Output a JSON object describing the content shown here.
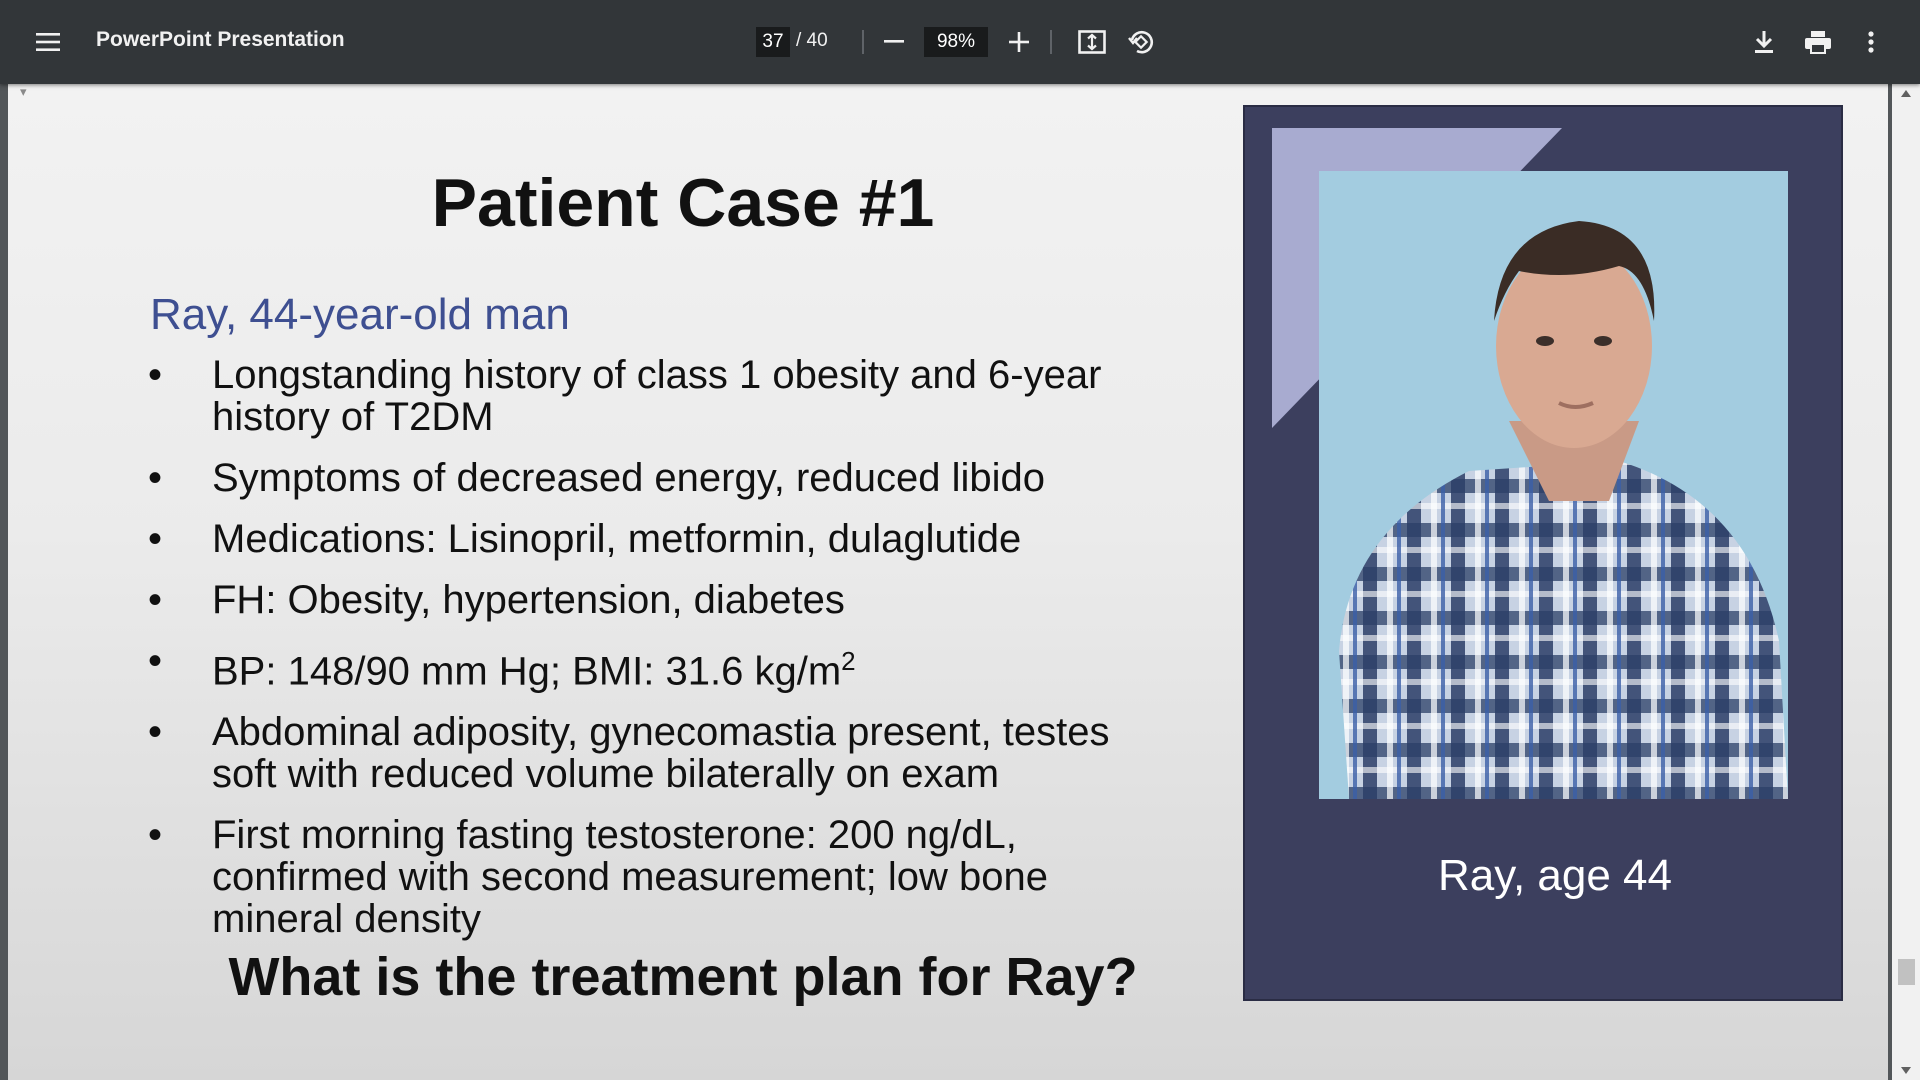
{
  "toolbar": {
    "menu_icon": "hamburger-menu-icon",
    "title": "PowerPoint Presentation",
    "current_page": "37",
    "page_total": "/ 40",
    "zoom_value": "98%",
    "zoom_out_icon": "minus-icon",
    "zoom_in_icon": "plus-icon",
    "fit_icon": "fit-to-page-icon",
    "rotate_icon": "rotate-icon",
    "download_icon": "download-icon",
    "print_icon": "print-icon",
    "more_icon": "more-vertical-icon"
  },
  "slide": {
    "title": "Patient Case #1",
    "subtitle": "Ray, 44-year-old man",
    "bullet_char": "•",
    "bullets": [
      "Longstanding history of class 1 obesity and 6-year history of T2DM",
      "Symptoms of decreased energy, reduced libido",
      "Medications: Lisinopril, metformin, dulaglutide",
      "FH: Obesity, hypertension, diabetes",
      "BP: 148/90 mm Hg; BMI: 31.6 kg/m",
      "Abdominal adiposity, gynecomastia present, testes soft with reduced volume bilaterally on exam",
      "First morning fasting testosterone: 200 ng/dL, confirmed with second measurement; low bone mineral density"
    ],
    "bmi_superscript": "2",
    "question": "What is the treatment plan for Ray?",
    "photo_caption": "Ray, age 44"
  },
  "colors": {
    "toolbar_bg": "#323639",
    "subtitle": "#3e4f91",
    "panel_bg": "#3c3f5e",
    "panel_accent": "#a8abd0",
    "photo_bg": "#a3cce0"
  }
}
